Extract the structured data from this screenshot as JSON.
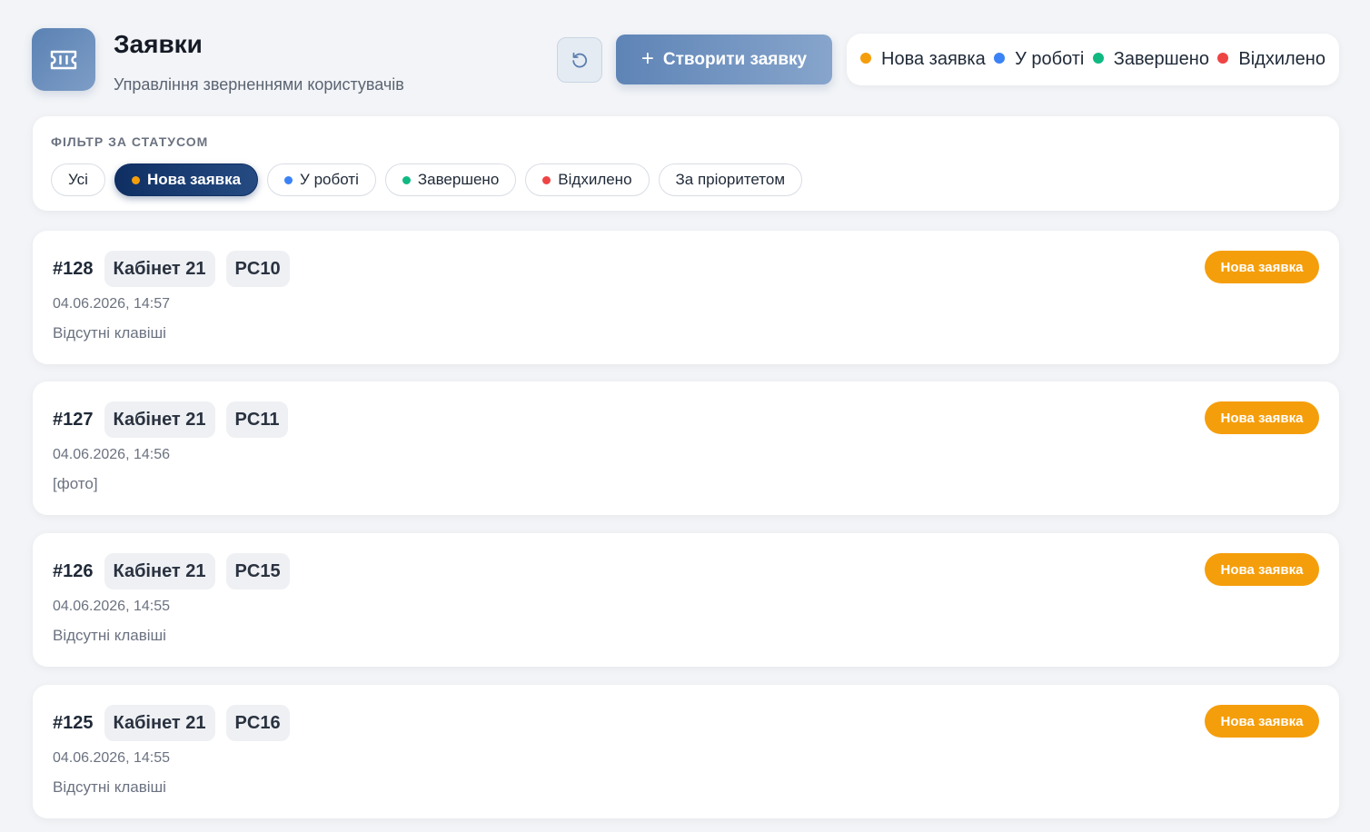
{
  "header": {
    "title": "Заявки",
    "subtitle": "Управління зверненнями користувачів",
    "app_icon": "ticket-icon",
    "refresh_icon": "refresh-icon",
    "create_label": "Створити заявку",
    "create_icon": "plus-icon"
  },
  "legend": [
    {
      "label": "Нова заявка",
      "color": "#f59e0b"
    },
    {
      "label": "У роботі",
      "color": "#3b82f6"
    },
    {
      "label": "Завершено",
      "color": "#10b981"
    },
    {
      "label": "Відхилено",
      "color": "#ef4444"
    }
  ],
  "filter": {
    "label": "ФІЛЬТР ЗА СТАТУСОМ",
    "chips": [
      {
        "label": "Усі",
        "color": null,
        "active": false
      },
      {
        "label": "Нова заявка",
        "color": "#f59e0b",
        "active": true
      },
      {
        "label": "У роботі",
        "color": "#3b82f6",
        "active": false
      },
      {
        "label": "Завершено",
        "color": "#10b981",
        "active": false
      },
      {
        "label": "Відхилено",
        "color": "#ef4444",
        "active": false
      },
      {
        "label": "За пріоритетом",
        "color": null,
        "active": false
      }
    ]
  },
  "tickets": [
    {
      "id": "#128",
      "room": "Кабінет 21",
      "pc": "PC10",
      "date": "04.06.2026, 14:57",
      "description": "Відсутні клавіші",
      "status": "Нова заявка",
      "status_color": "#f59e0b"
    },
    {
      "id": "#127",
      "room": "Кабінет 21",
      "pc": "PC11",
      "date": "04.06.2026, 14:56",
      "description": "[фото]",
      "status": "Нова заявка",
      "status_color": "#f59e0b"
    },
    {
      "id": "#126",
      "room": "Кабінет 21",
      "pc": "PC15",
      "date": "04.06.2026, 14:55",
      "description": "Відсутні клавіші",
      "status": "Нова заявка",
      "status_color": "#f59e0b"
    },
    {
      "id": "#125",
      "room": "Кабінет 21",
      "pc": "PC16",
      "date": "04.06.2026, 14:55",
      "description": "Відсутні клавіші",
      "status": "Нова заявка",
      "status_color": "#f59e0b"
    }
  ]
}
